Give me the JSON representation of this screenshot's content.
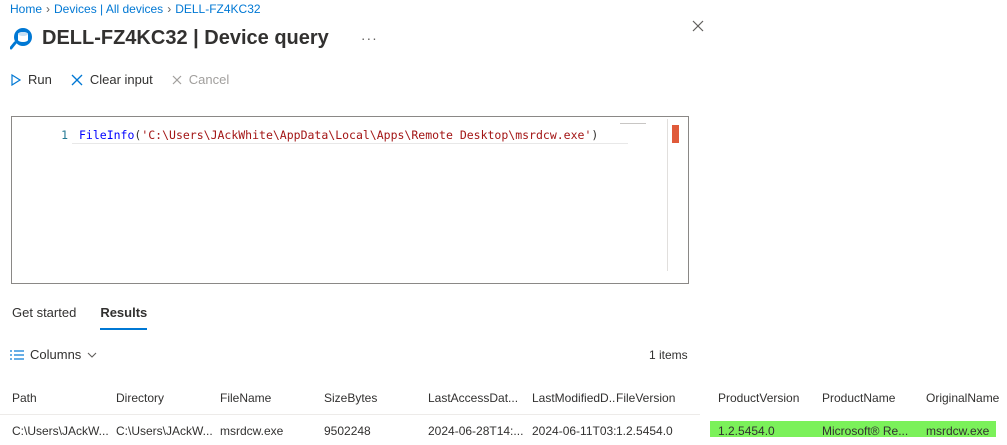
{
  "breadcrumb": {
    "items": [
      "Home",
      "Devices | All devices",
      "DELL-FZ4KC32"
    ]
  },
  "header": {
    "device_name": "DELL-FZ4KC32",
    "title_suffix": " | Device query",
    "more": "···"
  },
  "toolbar": {
    "run_label": "Run",
    "clear_label": "Clear input",
    "cancel_label": "Cancel"
  },
  "editor": {
    "line_number": "1",
    "code_fn": "FileInfo",
    "code_open": "(",
    "code_string": "'C:\\Users\\JAckWhite\\AppData\\Local\\Apps\\Remote Desktop\\msrdcw.exe'",
    "code_close": ")"
  },
  "tabs": [
    {
      "label": "Get started",
      "active": false
    },
    {
      "label": "Results",
      "active": true
    }
  ],
  "results": {
    "columns_label": "Columns",
    "items_count": "1 items",
    "headers": [
      "Path",
      "Directory",
      "FileName",
      "SizeBytes",
      "LastAccessDat...",
      "LastModifiedD...",
      "FileVersion",
      "ProductVersion",
      "ProductName",
      "OriginalName"
    ],
    "row": [
      "C:\\Users\\JAckW...",
      "C:\\Users\\JAckW...",
      "msrdcw.exe",
      "9502248",
      "2024-06-28T14:...",
      "2024-06-11T03:...",
      "1.2.5454.0",
      "1.2.5454.0",
      "Microsoft® Re...",
      "msrdcw.exe"
    ]
  },
  "colors": {
    "accent": "#0078d4",
    "highlight": "#7bf15a",
    "error_marker": "#e05a3a"
  }
}
